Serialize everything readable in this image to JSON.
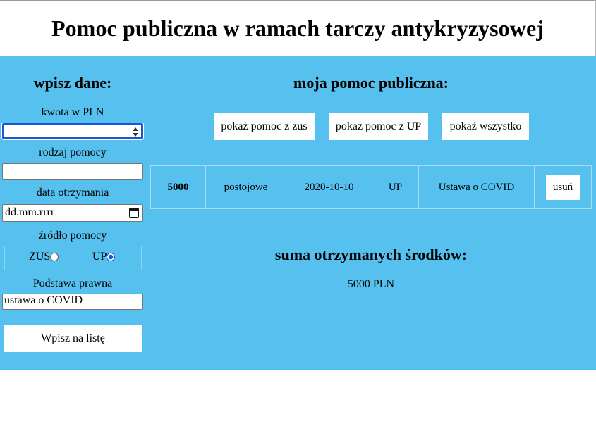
{
  "header": {
    "title": "Pomoc publiczna w ramach tarczy antykryzysowej"
  },
  "form": {
    "title": "wpisz dane:",
    "amount_label": "kwota w PLN",
    "amount_value": "",
    "type_label": "rodzaj pomocy",
    "type_value": "",
    "date_label": "data otrzymania",
    "date_placeholder": "dd.mm.rrrr",
    "source_label": "źródło pomocy",
    "source_options": [
      "ZUS",
      "UP"
    ],
    "source_selected": "UP",
    "legal_label": "Podstawa prawna",
    "legal_value": "ustawa o COVID",
    "submit_label": "Wpisz na listę"
  },
  "list": {
    "title": "moja pomoc publiczna:",
    "filters": [
      "pokaż pomoc z zus",
      "pokaż pomoc z UP",
      "pokaż wszystko"
    ],
    "rows": [
      {
        "amount": "5000",
        "type": "postojowe",
        "date": "2020-10-10",
        "source": "UP",
        "legal": "Ustawa o COVID",
        "delete_label": "usuń"
      }
    ]
  },
  "summary": {
    "title": "suma otrzymanych środków:",
    "value": "5000 PLN"
  },
  "colors": {
    "panel": "#56c1ef",
    "focus": "#1a57d8"
  }
}
